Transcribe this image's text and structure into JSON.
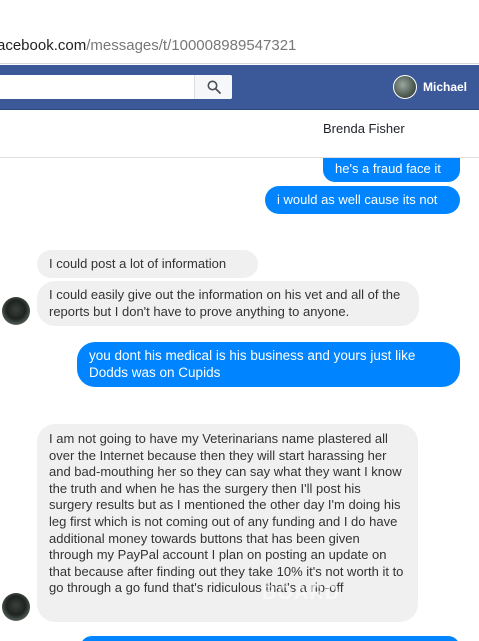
{
  "browser": {
    "url_host": "acebook.com",
    "url_path": "/messages/t/100008989547321"
  },
  "topbar": {
    "search_placeholder": "",
    "user_name": "Michael",
    "brand_color": "#3b5998"
  },
  "conversation": {
    "contact_name": "Brenda Fisher"
  },
  "messages": [
    {
      "direction": "out",
      "text": "he's a fraud face it"
    },
    {
      "direction": "out",
      "text": "i would as well cause its not"
    },
    {
      "direction": "in",
      "text": "I could post a lot of information"
    },
    {
      "direction": "in",
      "text": "I could easily give out the information on his vet and all of the reports but I don't have to prove anything to anyone."
    },
    {
      "direction": "out",
      "text": "you dont his medical is his business  and yours just like Dodds was on Cupids"
    },
    {
      "direction": "in",
      "text": "I am not going to have my Veterinarians name plastered all over the Internet because then they will start harassing her and bad-mouthing her so they can say what they want I know the truth and when he has the surgery then I'll post his surgery results but as I mentioned the other day I'm doing his leg first which is not coming out of any funding and I do have additional money towards buttons that has been given through my PayPal account I plan on posting an update on that because after finding out they take 10% it's not worth it to go through a go fund that's ridiculous that's a rip-off"
    }
  ],
  "watermark": "BOARD",
  "icons": {
    "search": "search-icon",
    "avatar": "user-avatar",
    "contact_avatar": "contact-avatar"
  },
  "colors": {
    "outgoing_bubble": "#0084ff",
    "incoming_bubble": "#f1f0f0"
  }
}
